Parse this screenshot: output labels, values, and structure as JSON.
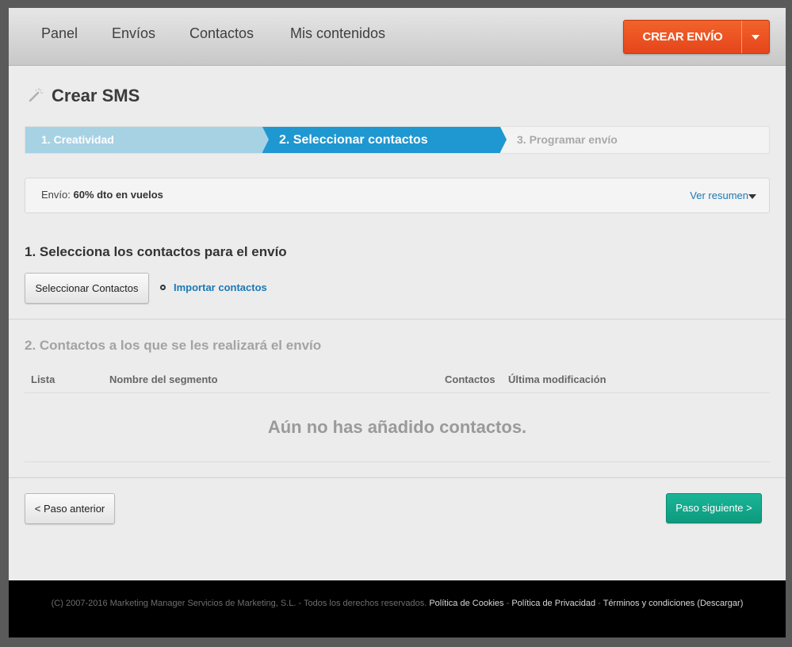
{
  "nav": {
    "items": [
      "Panel",
      "Envíos",
      "Contactos",
      "Mis contenidos"
    ],
    "create_button": "CREAR ENVÍO"
  },
  "page": {
    "title": "Crear SMS"
  },
  "steps": [
    "1. Creatividad",
    "2. Seleccionar contactos",
    "3. Programar envío"
  ],
  "envio": {
    "label": "Envío:",
    "name": "60% dto en vuelos",
    "summary_link": "Ver resumen"
  },
  "section1": {
    "title": "1. Selecciona los contactos para el envío",
    "select_button": "Seleccionar Contactos",
    "import_link": "Importar contactos"
  },
  "section2": {
    "title": "2. Contactos a los que se les realizará el envío",
    "columns": [
      "Lista",
      "Nombre del segmento",
      "Contactos",
      "Última modificación"
    ],
    "empty_message": "Aún no has añadido contactos."
  },
  "buttons": {
    "prev": "< Paso anterior",
    "next": "Paso siguiente >"
  },
  "footer": {
    "copyright": "(C) 2007-2016 Marketing Manager Servicios de Marketing, S.L. - Todos los derechos reservados.",
    "cookies": "Política de Cookies",
    "sep": " - ",
    "privacy": "Política de Privacidad",
    "terms": "Términos y condiciones (Descargar)"
  },
  "colors": {
    "accent_orange": "#e5451b",
    "step_active": "#1f97d0",
    "step_done": "#a6d2e4",
    "link_blue": "#1a78b5",
    "next_green": "#0e9a7e"
  }
}
